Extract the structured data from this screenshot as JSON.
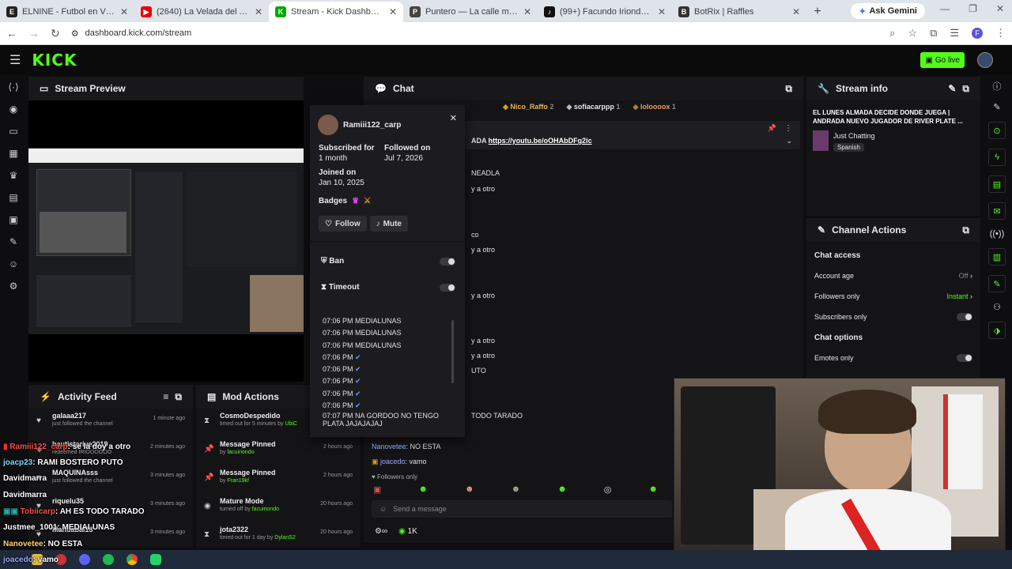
{
  "browser": {
    "tabs": [
      {
        "title": "ELNINE - Futbol en Vivo",
        "fav": "E",
        "color": "#222"
      },
      {
        "title": "(2640) La Velada del Año Desde",
        "fav": "▶",
        "color": "#e00"
      },
      {
        "title": "Stream - Kick Dashboard",
        "fav": "K",
        "color": "#0a0"
      },
      {
        "title": "Puntero — La calle manda",
        "fav": "P",
        "color": "#444"
      },
      {
        "title": "(99+) Facundo Iriondo (@facu",
        "fav": "♪",
        "color": "#111"
      },
      {
        "title": "BotRix | Raffles",
        "fav": "B",
        "color": "#333"
      }
    ],
    "gemini_label": "Ask Gemini",
    "url": "dashboard.kick.com/stream"
  },
  "header": {
    "logo": "KICK",
    "go_live": "Go live"
  },
  "preview": {
    "title": "Stream Preview"
  },
  "activity": {
    "title": "Activity Feed",
    "items": [
      {
        "name": "galaaa217",
        "sub": "just followed the channel",
        "time": "1 minute ago"
      },
      {
        "name": "bautistarive2019",
        "sub": "redeemed IRIOOOOOO",
        "time": "2 minutes ago"
      },
      {
        "name": "MAQUINAsss",
        "sub": "just followed the channel",
        "time": "3 minutes ago"
      },
      {
        "name": "riquelu35",
        "sub": "",
        "time": "3 minutes ago"
      },
      {
        "name": "Manuabal13",
        "sub": "",
        "time": "3 minutes ago"
      }
    ]
  },
  "modactions": {
    "title": "Mod Actions",
    "items": [
      {
        "name": "CosmoDespedido",
        "sub": "timed out for 5 minutes by ",
        "by": "UbiC",
        "time": ""
      },
      {
        "name": "Message Pinned",
        "sub": "by ",
        "by": "facuiriondo",
        "time": "2 hours ago"
      },
      {
        "name": "Message Pinned",
        "sub": "by ",
        "by": "Fran19kf",
        "time": "2 hours ago"
      },
      {
        "name": "Mature Mode",
        "sub": "turned off by ",
        "by": "facuiriondo",
        "time": "20 hours ago"
      },
      {
        "name": "jota2322",
        "sub": "timed out for 1 day by ",
        "by": "DylanS2",
        "time": "20 hours ago"
      }
    ]
  },
  "chat": {
    "title": "Chat",
    "top_gifters": [
      {
        "name": "Nico_Raffo",
        "n": "2"
      },
      {
        "name": "sofiacarppp",
        "n": "1"
      },
      {
        "name": "loloooox",
        "n": "1"
      }
    ],
    "pinned_prefix": "ADA ",
    "pinned_link": "https://youtu.be/oOHAbDFg2ic",
    "fragments": [
      "NEADLA",
      "y a otro",
      "co",
      "y a otro",
      "y a otro",
      "y a otro",
      "y a otro",
      "UTO",
      "TODO TARADO"
    ],
    "msg1_user": "Nanovetee",
    "msg1_text": ": NO ESTA",
    "msg2_user": "joacedo",
    "msg2_text": ": vamo",
    "followers_only": "Followers only",
    "send_placeholder": "Send a message",
    "viewers": "1K"
  },
  "usercard": {
    "username": "Ramiii122_carp",
    "sub_label": "Subscribed for",
    "sub_value": "1 month",
    "follow_label": "Followed on",
    "follow_value": "Jul 7, 2026",
    "joined_label": "Joined on",
    "joined_value": "Jan 10, 2025",
    "badges_label": "Badges",
    "follow_btn": "Follow",
    "mute_btn": "Mute",
    "ban_label": "Ban",
    "timeout_label": "Timeout",
    "history": [
      "07:06 PM MEDIALUNAS",
      "07:06 PM MEDIALUNAS",
      "07:06 PM MEDIALUNAS",
      "07:06 PM",
      "07:06 PM",
      "07:06 PM",
      "07:06 PM",
      "07:06 PM",
      "07:07 PM NA GORDOO NO TENGO PLATA JAJAJAJAJ"
    ]
  },
  "streaminfo": {
    "title": "Stream info",
    "stream_title": "EL LUNES ALMADA DECIDE DONDE JUEGA | ANDRADA NUEVO JUGADOR DE RIVER PLATE ...",
    "category": "Just Chatting",
    "language": "Spanish"
  },
  "channelactions": {
    "title": "Channel Actions",
    "chat_access": "Chat access",
    "account_age": "Account age",
    "account_age_val": "Off",
    "followers_only": "Followers only",
    "followers_only_val": "Instant",
    "subscribers_only": "Subscribers only",
    "chat_options": "Chat options",
    "emotes_only": "Emotes only"
  },
  "overlay": [
    {
      "user": "Ramiii122_carp",
      "text": ": se la doy a otro",
      "color": "#ff4d4d"
    },
    {
      "user": "joacp23",
      "text": ": RAMI BOSTERO PUTO",
      "color": "#7fd7ff"
    },
    {
      "user": "Davidmarra",
      "text": "",
      "color": "#ffffff"
    },
    {
      "user": "Davidmarra",
      "text": "",
      "color": "#ffffff"
    },
    {
      "user": "Tobiicarp",
      "text": ": AH ES TODO TARADO",
      "color": "#ff4d4d"
    },
    {
      "user": "Justmee_1001",
      "text": ": MEDIALUNAS",
      "color": "#ffffff"
    },
    {
      "user": "Nanovetee",
      "text": ": NO ESTA",
      "color": "#ffd36b"
    },
    {
      "user": "joacedo",
      "text": ": vamo",
      "color": "#9fa8ff"
    }
  ],
  "colors": {
    "accent": "#53fc18",
    "panel": "#141417",
    "bg": "#0e0e10"
  }
}
